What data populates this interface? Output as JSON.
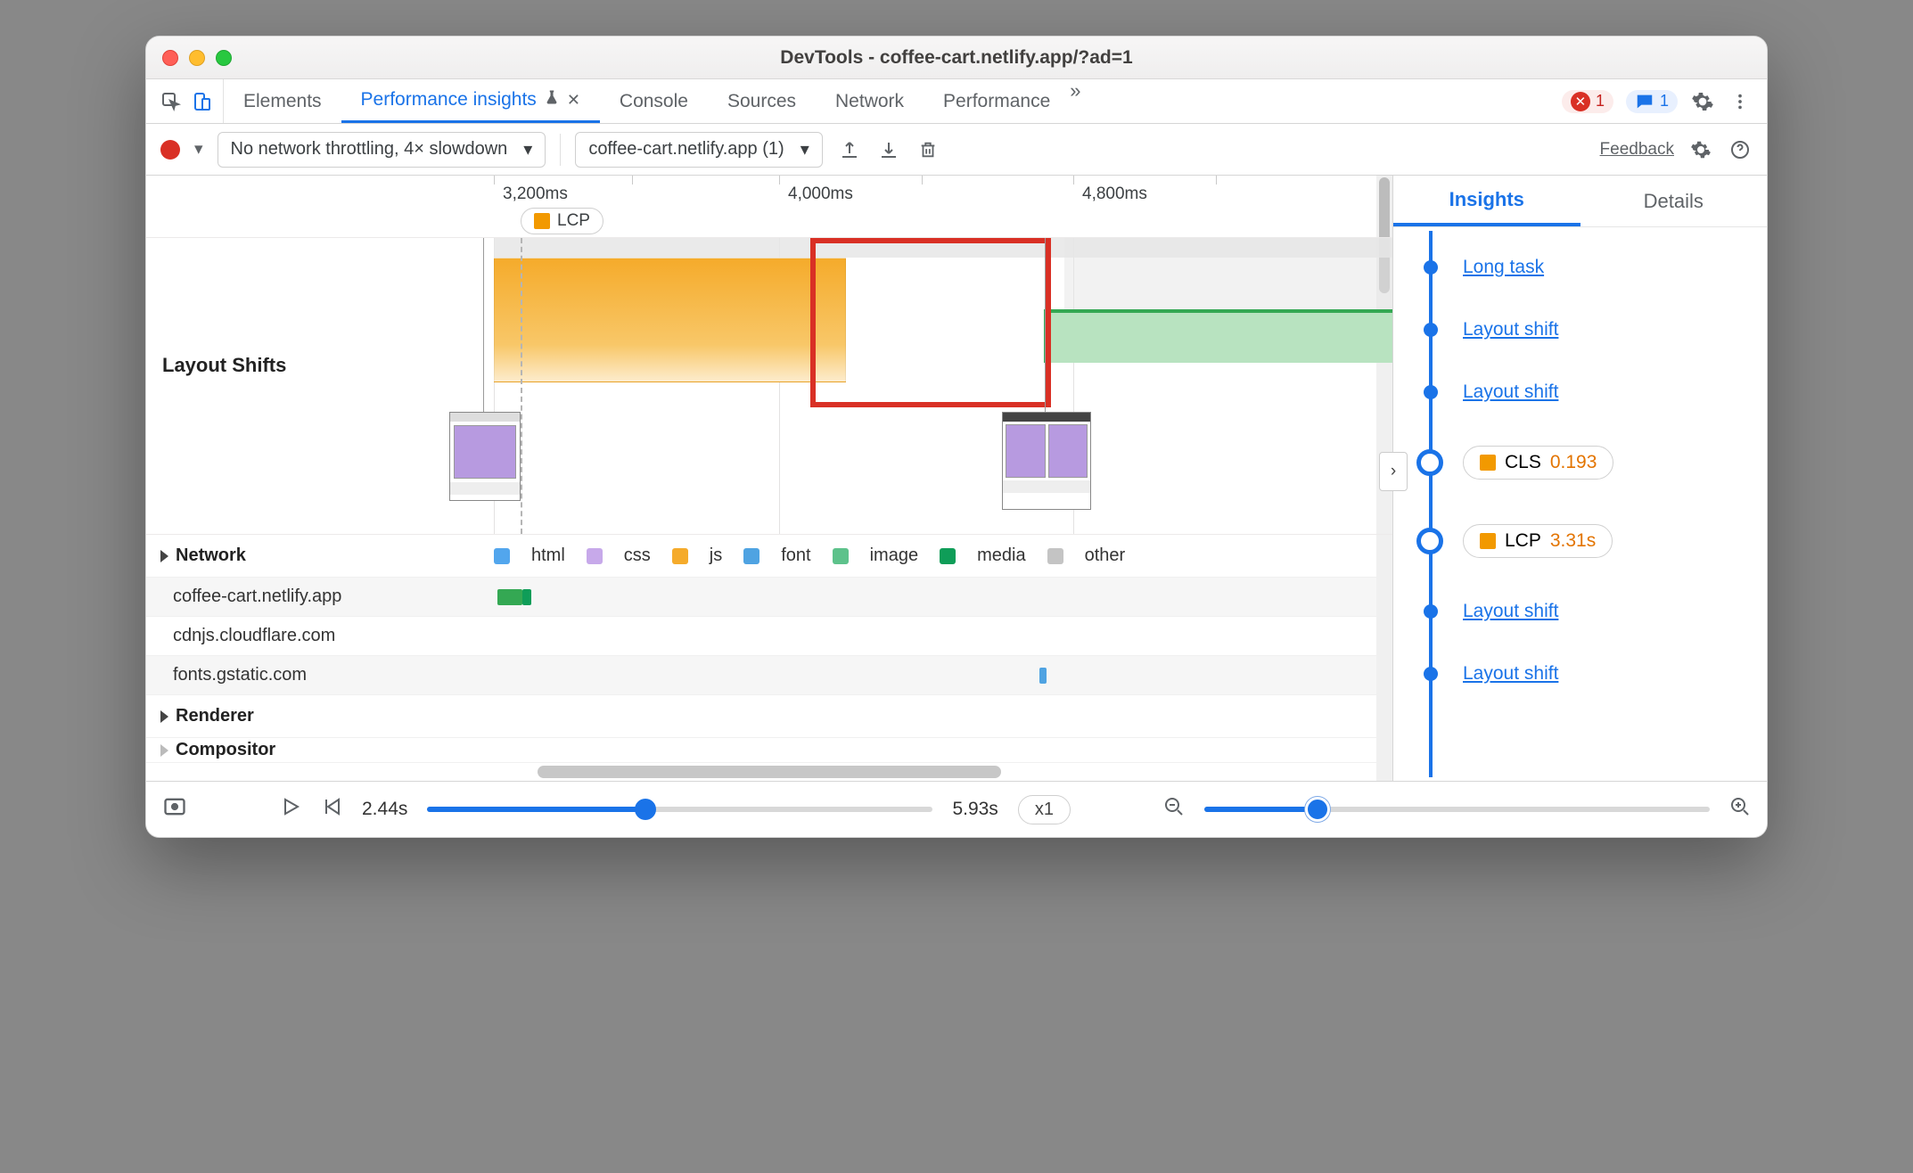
{
  "window": {
    "title": "DevTools - coffee-cart.netlify.app/?ad=1"
  },
  "top_tabs": {
    "items": [
      "Elements",
      "Performance insights",
      "Console",
      "Sources",
      "Network",
      "Performance"
    ],
    "active": "Performance insights",
    "err_count": "1",
    "msg_count": "1"
  },
  "toolbar": {
    "throttle": "No network throttling, 4× slowdown",
    "pagechip": "coffee-cart.netlify.app (1)",
    "feedback": "Feedback"
  },
  "timeline": {
    "ticks": [
      "3,200ms",
      "4,000ms",
      "4,800ms"
    ],
    "lcp_chip": "LCP"
  },
  "sections": {
    "layout_shifts": "Layout Shifts",
    "network": "Network",
    "renderer": "Renderer",
    "compositor": "Compositor"
  },
  "legend": {
    "html": "html",
    "css": "css",
    "js": "js",
    "font": "font",
    "image": "image",
    "media": "media",
    "other": "other"
  },
  "network_rows": [
    "coffee-cart.netlify.app",
    "cdnjs.cloudflare.com",
    "fonts.gstatic.com"
  ],
  "right": {
    "tabs": {
      "insights": "Insights",
      "details": "Details"
    },
    "items": [
      {
        "type": "link",
        "label": "Long task"
      },
      {
        "type": "link",
        "label": "Layout shift"
      },
      {
        "type": "link",
        "label": "Layout shift"
      },
      {
        "type": "metric",
        "name": "CLS",
        "value": "0.193"
      },
      {
        "type": "metric",
        "name": "LCP",
        "value": "3.31s"
      },
      {
        "type": "link",
        "label": "Layout shift"
      },
      {
        "type": "link",
        "label": "Layout shift"
      }
    ]
  },
  "footer": {
    "start": "2.44s",
    "end": "5.93s",
    "speed": "x1"
  }
}
